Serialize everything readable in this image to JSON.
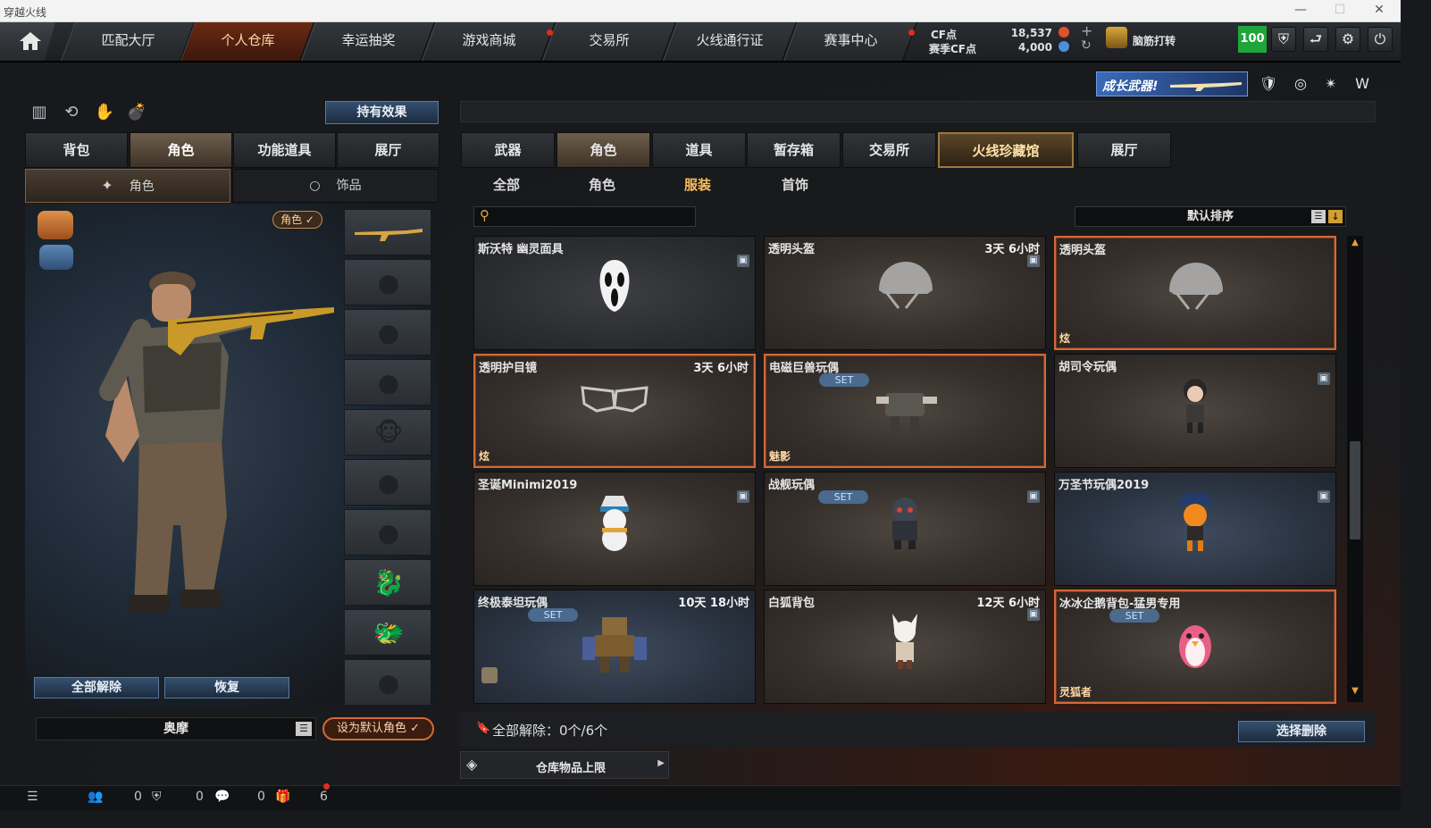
{
  "window": {
    "title": "穿越火线",
    "min": "—",
    "max": "☐",
    "close": "✕"
  },
  "nav": {
    "home_icon": "home-icon",
    "tabs": [
      {
        "label": "匹配大厅",
        "active": false,
        "dot": false
      },
      {
        "label": "个人仓库",
        "active": true,
        "dot": false
      },
      {
        "label": "幸运抽奖",
        "active": false,
        "dot": false
      },
      {
        "label": "游戏商城",
        "active": false,
        "dot": true
      },
      {
        "label": "交易所",
        "active": false,
        "dot": false
      },
      {
        "label": "火线通行证",
        "active": false,
        "dot": false
      },
      {
        "label": "赛事中心",
        "active": false,
        "dot": true
      }
    ]
  },
  "currency": {
    "cf_label": "CF点",
    "cf_value": "18,537",
    "season_label": "赛季CF点",
    "season_value": "4,000",
    "plus": "+",
    "refresh": "↻"
  },
  "user": {
    "name": "脑筋打转",
    "level": "100"
  },
  "promo": {
    "text": "成长武器!"
  },
  "left": {
    "effect_button": "持有效果",
    "tabs": [
      "背包",
      "角色",
      "功能道具",
      "展厅"
    ],
    "subtabs": [
      "角色",
      "饰品"
    ],
    "role_badge": "角色 ✓",
    "clear_all": "全部解除",
    "restore": "恢复",
    "char_name": "奥摩",
    "set_default": "设为默认角色 ✓"
  },
  "right": {
    "tabs": [
      "武器",
      "角色",
      "道具",
      "暂存箱",
      "交易所",
      "火线珍藏馆",
      "展厅"
    ],
    "filters": [
      "全部",
      "角色",
      "服装",
      "首饰"
    ],
    "search_placeholder": "",
    "sort": "默认排序",
    "items": [
      {
        "name": "斯沃特 幽灵面具",
        "time": "",
        "tag": "",
        "set": false,
        "lock": true,
        "style": "grey",
        "sel": false,
        "icon": "ghost-mask-icon"
      },
      {
        "name": "透明头盔",
        "time": "3天 6小时",
        "tag": "",
        "set": false,
        "lock": true,
        "style": "brown",
        "sel": false,
        "icon": "helmet-icon"
      },
      {
        "name": "透明头盔",
        "time": "",
        "tag": "炫",
        "set": false,
        "lock": false,
        "style": "brown",
        "sel": true,
        "icon": "helmet-icon"
      },
      {
        "name": "透明护目镜",
        "time": "3天 6小时",
        "tag": "炫",
        "set": false,
        "lock": false,
        "style": "brown",
        "sel": true,
        "icon": "goggles-icon"
      },
      {
        "name": "电磁巨兽玩偶",
        "time": "",
        "tag": "魅影",
        "set": true,
        "lock": false,
        "style": "brown",
        "sel": true,
        "icon": "mech-doll-icon"
      },
      {
        "name": "胡司令玩偶",
        "time": "",
        "tag": "",
        "set": false,
        "lock": true,
        "style": "brown",
        "sel": false,
        "icon": "figure-doll-icon"
      },
      {
        "name": "圣诞Minimi2019",
        "time": "",
        "tag": "",
        "set": false,
        "lock": true,
        "style": "brown",
        "sel": false,
        "icon": "snowman-doll-icon"
      },
      {
        "name": "战舰玩偶",
        "time": "",
        "tag": "",
        "set": true,
        "lock": true,
        "style": "brown",
        "sel": false,
        "icon": "robot-doll-icon"
      },
      {
        "name": "万圣节玩偶2019",
        "time": "",
        "tag": "",
        "set": false,
        "lock": true,
        "style": "blue",
        "sel": false,
        "icon": "pumpkin-doll-icon"
      },
      {
        "name": "终极泰坦玩偶",
        "time": "10天 18小时",
        "tag": "",
        "set": true,
        "lock": false,
        "style": "blue",
        "sel": false,
        "icon": "titan-doll-icon"
      },
      {
        "name": "白狐背包",
        "time": "12天 6小时",
        "tag": "",
        "set": false,
        "lock": true,
        "style": "brown",
        "sel": false,
        "icon": "fox-backpack-icon"
      },
      {
        "name": "冰冰企鹅背包-猛男专用",
        "time": "",
        "tag": "灵狐者",
        "set": true,
        "lock": false,
        "style": "brown",
        "sel": true,
        "icon": "penguin-backpack-icon"
      }
    ],
    "set_label": "SET",
    "clear_info": "全部解除：0个/6个",
    "select_delete": "选择删除",
    "capacity": "仓库物品上限"
  },
  "bottom": {
    "c1": "0",
    "c2": "0",
    "c3": "0",
    "c4": "6"
  }
}
